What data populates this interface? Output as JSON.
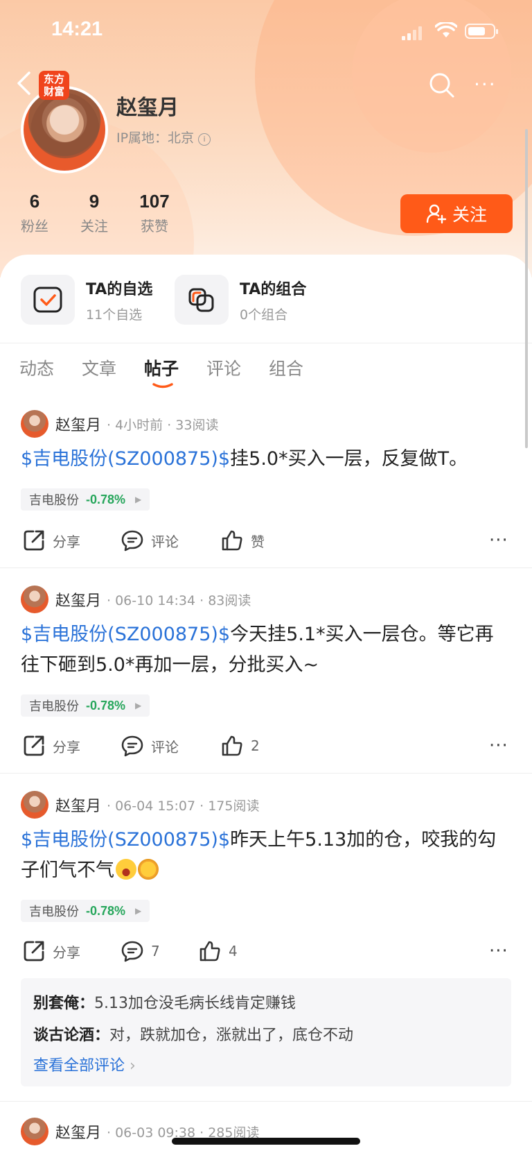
{
  "status_bar": {
    "time": "14:21"
  },
  "app_badge": {
    "line1": "东方",
    "line2": "财富"
  },
  "profile": {
    "name": "赵玺月",
    "ip_location": "IP属地：北京"
  },
  "stats": [
    {
      "value": "6",
      "label": "粉丝"
    },
    {
      "value": "9",
      "label": "关注"
    },
    {
      "value": "107",
      "label": "获赞"
    }
  ],
  "follow_label": "关注",
  "quick_links": [
    {
      "title": "TA的自选",
      "sub": "11个自选"
    },
    {
      "title": "TA的组合",
      "sub": "0个组合"
    }
  ],
  "tabs": [
    "动态",
    "文章",
    "帖子",
    "评论",
    "组合"
  ],
  "active_tab": "帖子",
  "posts": [
    {
      "author": "赵玺月",
      "meta": "· 4小时前 · 33阅读",
      "stock": "$吉电股份(SZ000875)$",
      "text": "挂5.0*买入一层，反复做T。",
      "tag_name": "吉电股份",
      "tag_change": "-0.78%",
      "share": "分享",
      "comment": "评论",
      "like": "赞"
    },
    {
      "author": "赵玺月",
      "meta": "· 06-10 14:34 · 83阅读",
      "stock": "$吉电股份(SZ000875)$",
      "text": "今天挂5.1*买入一层仓。等它再往下砸到5.0*再加一层，分批买入~",
      "tag_name": "吉电股份",
      "tag_change": "-0.78%",
      "share": "分享",
      "comment": "评论",
      "like": "2"
    },
    {
      "author": "赵玺月",
      "meta": "· 06-04 15:07 · 175阅读",
      "stock": "$吉电股份(SZ000875)$",
      "text": "昨天上午5.13加的仓，咬我的勾子们气不气",
      "tag_name": "吉电股份",
      "tag_change": "-0.78%",
      "share": "分享",
      "comment": "7",
      "like": "4"
    },
    {
      "author": "赵玺月",
      "meta": "· 06-03 09:38 · 285阅读"
    }
  ],
  "comments": [
    {
      "user": "别套俺：",
      "text": "5.13加仓没毛病长线肯定赚钱"
    },
    {
      "user": "谈古论酒：",
      "text": "对，跌就加仓，涨就出了，底仓不动"
    }
  ],
  "view_all_comments": "查看全部评论",
  "colors": {
    "accent": "#ff5a18",
    "stock_link": "#2a72d8",
    "change_green": "#26a65b"
  }
}
